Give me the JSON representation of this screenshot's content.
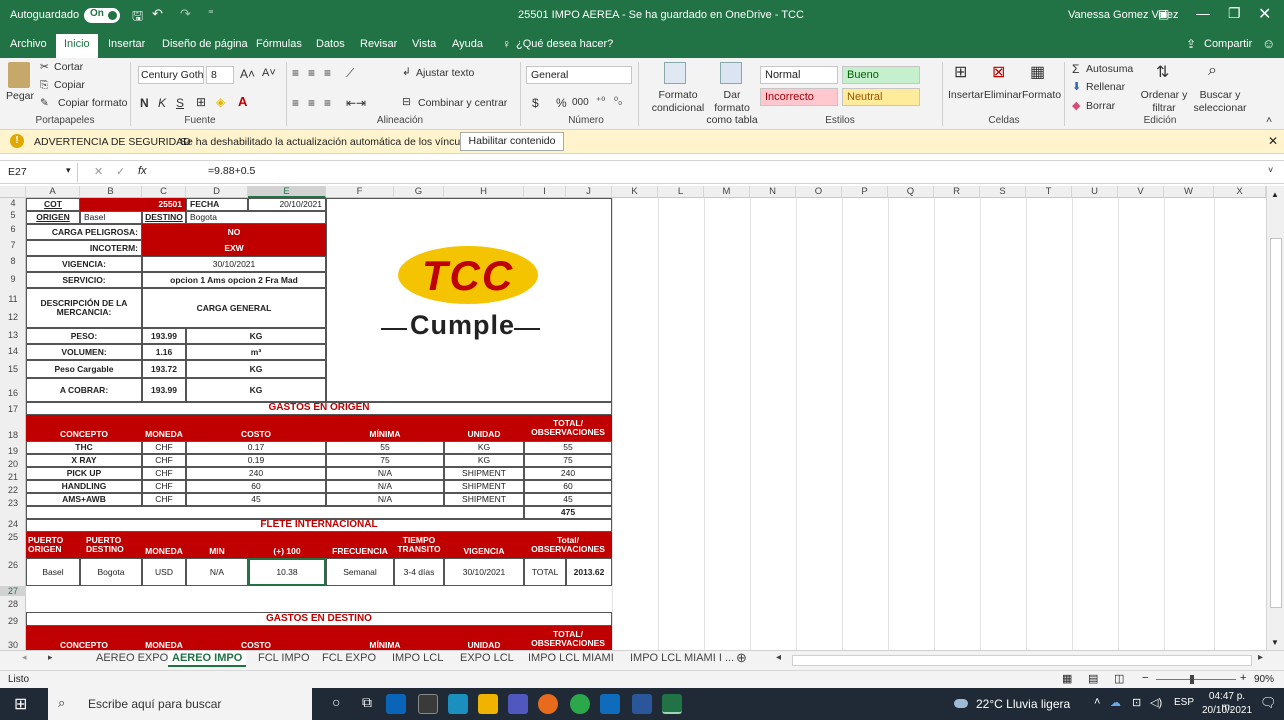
{
  "titlebar": {
    "autosave": "Autoguardado",
    "toggle": "•",
    "title": "25501 IMPO AEREA  -  Se ha guardado en OneDrive - TCC",
    "user": "Vanessa Gomez Velez"
  },
  "menu": {
    "items": [
      "Archivo",
      "Inicio",
      "Insertar",
      "Diseño de página",
      "Fórmulas",
      "Datos",
      "Revisar",
      "Vista",
      "Ayuda"
    ],
    "search": "¿Qué desea hacer?",
    "share": "Compartir"
  },
  "ribbon": {
    "clipboard": {
      "paste": "Pegar",
      "cut": "Cortar",
      "copy": "Copiar",
      "format_painter": "Copiar formato",
      "label": "Portapapeles"
    },
    "font": {
      "name": "Century Gothic",
      "size": "8",
      "bold": "N",
      "italic": "K",
      "underline": "S",
      "label": "Fuente"
    },
    "align": {
      "wrap": "Ajustar texto",
      "merge": "Combinar y centrar",
      "label": "Alineación"
    },
    "number": {
      "format": "General",
      "currency": "$",
      "percent": "%",
      "thousands": "000",
      "label": "Número"
    },
    "styles": {
      "cond": "Formato condicional",
      "table": "Dar formato como tabla",
      "normal": "Normal",
      "bueno": "Bueno",
      "incorrecto": "Incorrecto",
      "neutral": "Neutral",
      "label": "Estilos"
    },
    "cells": {
      "insert": "Insertar",
      "delete": "Eliminar",
      "format": "Formato",
      "label": "Celdas"
    },
    "editing": {
      "autosum": "Autosuma",
      "fill": "Rellenar",
      "clear": "Borrar",
      "sort": "Ordenar y filtrar",
      "find": "Buscar y seleccionar",
      "label": "Edición"
    }
  },
  "security": {
    "title": "ADVERTENCIA DE SEGURIDAD",
    "message": "Se ha deshabilitado la actualización automática de los vínculos",
    "button": "Habilitar contenido"
  },
  "formula": {
    "namebox": "E27",
    "fx": "fx",
    "value": "=9.88+0.5"
  },
  "columns": [
    "A",
    "B",
    "C",
    "D",
    "E",
    "F",
    "G",
    "H",
    "I",
    "J",
    "K",
    "L",
    "M",
    "N",
    "O",
    "P",
    "Q",
    "R",
    "S",
    "T",
    "U",
    "V",
    "W",
    "X"
  ],
  "rows": [
    "4",
    "5",
    "6",
    "7",
    "8",
    "9",
    "11",
    "12",
    "13",
    "14",
    "15",
    "16",
    "17",
    "18",
    "19",
    "20",
    "21",
    "22",
    "23",
    "24",
    "25",
    "26",
    "27",
    "28",
    "29",
    "30"
  ],
  "sheet": {
    "cot_label": "COT",
    "cot_value": "25501",
    "fecha_label": "FECHA",
    "fecha_value": "20/10/2021",
    "origen_label": "ORIGEN",
    "origen_value": "Basel",
    "destino_label": "DESTINO",
    "destino_value": "Bogota",
    "carga_label": "CARGA PELIGROSA:",
    "carga_value": "NO",
    "incoterm_label": "INCOTERM:",
    "incoterm_value": "EXW",
    "vigencia_label": "VIGENCIA:",
    "vigencia_value": "30/10/2021",
    "servicio_label": "SERVICIO:",
    "servicio_value": "opcion 1 Ams opcion 2 Fra Mad",
    "desc_label": "DESCRIPCIÓN DE LA MERCANCIA:",
    "desc_value": "CARGA GENERAL",
    "peso_label": "PESO:",
    "peso_value": "193.99",
    "peso_unit": "KG",
    "vol_label": "VOLUMEN:",
    "vol_value": "1.16",
    "vol_unit": "m³",
    "pc_label": "Peso Cargable",
    "pc_value": "193.72",
    "pc_unit": "KG",
    "cobrar_label": "A COBRAR:",
    "cobrar_value": "193.99",
    "cobrar_unit": "KG",
    "logo_top": "TCC",
    "logo_bottom": "Cumple",
    "origen_section": "GASTOS EN ORIGEN",
    "headers": {
      "concepto": "CONCEPTO",
      "moneda": "MONEDA",
      "costo": "COSTO",
      "minima": "MÍNIMA",
      "unidad": "UNIDAD",
      "total": "TOTAL/ OBSERVACIONES"
    },
    "origen_rows": [
      {
        "concepto": "THC",
        "moneda": "CHF",
        "costo": "0.17",
        "minima": "55",
        "unidad": "KG",
        "total": "55"
      },
      {
        "concepto": "X RAY",
        "moneda": "CHF",
        "costo": "0.19",
        "minima": "75",
        "unidad": "KG",
        "total": "75"
      },
      {
        "concepto": "PICK UP",
        "moneda": "CHF",
        "costo": "240",
        "minima": "N/A",
        "unidad": "SHIPMENT",
        "total": "240"
      },
      {
        "concepto": "HANDLING",
        "moneda": "CHF",
        "costo": "60",
        "minima": "N/A",
        "unidad": "SHIPMENT",
        "total": "60"
      },
      {
        "concepto": "AMS+AWB",
        "moneda": "CHF",
        "costo": "45",
        "minima": "N/A",
        "unidad": "SHIPMENT",
        "total": "45"
      }
    ],
    "origen_total": "475",
    "flete_section": "FLETE INTERNACIONAL",
    "flete_headers": {
      "po": "PUERTO ORIGEN",
      "pd": "PUERTO DESTINO",
      "moneda": "MONEDA",
      "min": "MIN",
      "c100": "(+) 100",
      "frec": "FRECUENCIA",
      "tt": "TIEMPO TRANSITO",
      "vig": "VIGENCIA",
      "total": "Total/ OBSERVACIONES"
    },
    "flete_row": {
      "po": "Basel",
      "pd": "Bogota",
      "moneda": "USD",
      "min": "N/A",
      "c100": "10.38",
      "frec": "Semanal",
      "tt": "3-4 días",
      "vig": "30/10/2021",
      "tl": "TOTAL",
      "tv": "2013.62"
    },
    "destino_section": "GASTOS EN DESTINO"
  },
  "tabs": {
    "items": [
      "AEREO EXPO",
      "AEREO IMPO",
      "FCL IMPO",
      "FCL EXPO",
      "IMPO LCL",
      "EXPO LCL",
      "IMPO LCL MIAMI",
      "IMPO LCL MIAMI I ..."
    ],
    "active": "AEREO IMPO"
  },
  "status": {
    "ready": "Listo",
    "zoom": "90%"
  },
  "taskbar": {
    "search": "Escribe aquí para buscar",
    "weather": "22°C  Lluvia ligera",
    "lang": "ESP",
    "time": "04:47 p. m.",
    "date": "20/10/2021"
  },
  "colors": {
    "excel_green": "#217346",
    "red": "#c00000"
  }
}
